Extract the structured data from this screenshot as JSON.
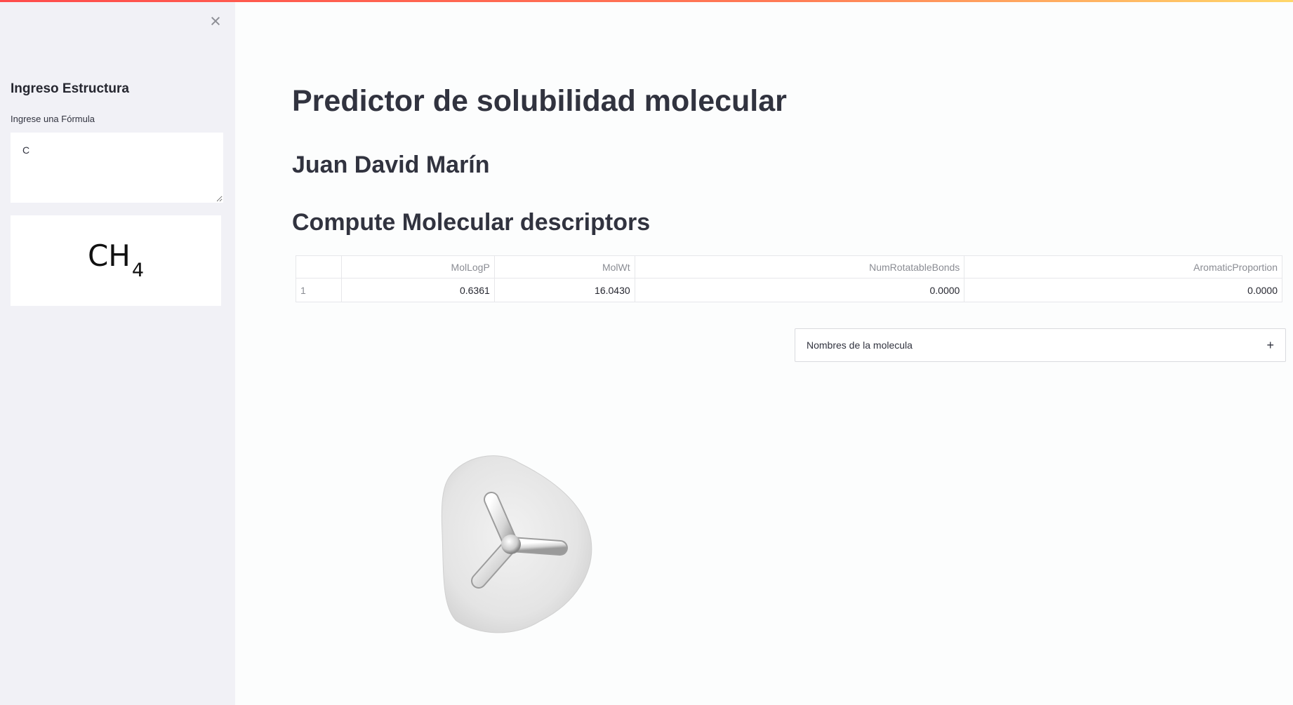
{
  "sidebar": {
    "close_icon": "×",
    "heading": "Ingreso Estructura",
    "input_label": "Ingrese una Fórmula",
    "input_value": "C",
    "formula_main": "CH",
    "formula_sub": "4"
  },
  "main": {
    "title": "Predictor de solubilidad molecular",
    "author": "Juan David Marín",
    "section_title": "Compute Molecular descriptors",
    "table": {
      "columns": [
        "",
        "MolLogP",
        "MolWt",
        "NumRotatableBonds",
        "AromaticProportion"
      ],
      "rows": [
        [
          "1",
          "0.6361",
          "16.0430",
          "0.0000",
          "0.0000"
        ]
      ]
    },
    "expander": {
      "label": "Nombres de la molecula",
      "icon": "+"
    }
  },
  "colors": {
    "accent": "#ff4b4b",
    "sidebar_bg": "#f1f1f6",
    "text": "#31333f"
  },
  "icons": {
    "close": "close-icon",
    "expand": "plus-icon"
  }
}
